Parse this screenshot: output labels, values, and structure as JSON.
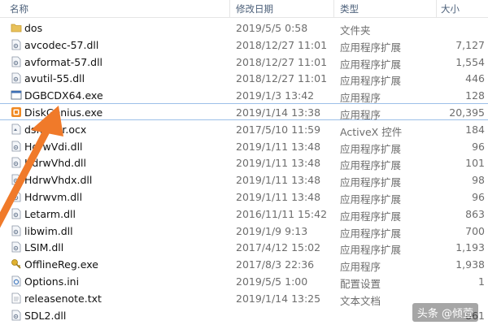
{
  "columns": {
    "name": "名称",
    "date": "修改日期",
    "type": "类型",
    "size": "大小"
  },
  "files": [
    {
      "name": "dos",
      "date": "2019/5/5 0:58",
      "type": "文件夹",
      "size": "",
      "icon": "folder-icon"
    },
    {
      "name": "avcodec-57.dll",
      "date": "2018/12/27 11:01",
      "type": "应用程序扩展",
      "size": "7,127",
      "icon": "dll-icon"
    },
    {
      "name": "avformat-57.dll",
      "date": "2018/12/27 11:01",
      "type": "应用程序扩展",
      "size": "1,554",
      "icon": "dll-icon"
    },
    {
      "name": "avutil-55.dll",
      "date": "2018/12/27 11:01",
      "type": "应用程序扩展",
      "size": "446",
      "icon": "dll-icon"
    },
    {
      "name": "DGBCDX64.exe",
      "date": "2019/1/3 13:42",
      "type": "应用程序",
      "size": "128",
      "icon": "exe-icon"
    },
    {
      "name": "DiskGenius.exe",
      "date": "2019/1/14 13:38",
      "type": "应用程序",
      "size": "20,395",
      "icon": "diskgenius-icon",
      "selected": true
    },
    {
      "name": "dsfamer.ocx",
      "date": "2017/5/10 11:59",
      "type": "ActiveX 控件",
      "size": "184",
      "icon": "ocx-icon"
    },
    {
      "name": "HdrwVdi.dll",
      "date": "2019/1/11 13:48",
      "type": "应用程序扩展",
      "size": "96",
      "icon": "dll-icon"
    },
    {
      "name": "HdrwVhd.dll",
      "date": "2019/1/11 13:48",
      "type": "应用程序扩展",
      "size": "101",
      "icon": "dll-icon"
    },
    {
      "name": "HdrwVhdx.dll",
      "date": "2019/1/11 13:48",
      "type": "应用程序扩展",
      "size": "98",
      "icon": "dll-icon"
    },
    {
      "name": "Hdrwvm.dll",
      "date": "2019/1/11 13:48",
      "type": "应用程序扩展",
      "size": "96",
      "icon": "dll-icon"
    },
    {
      "name": "Letarm.dll",
      "date": "2016/11/11 15:42",
      "type": "应用程序扩展",
      "size": "863",
      "icon": "dll-icon"
    },
    {
      "name": "libwim.dll",
      "date": "2019/1/9 9:13",
      "type": "应用程序扩展",
      "size": "700",
      "icon": "dll-icon"
    },
    {
      "name": "LSIM.dll",
      "date": "2017/4/12 15:02",
      "type": "应用程序扩展",
      "size": "1,193",
      "icon": "dll-icon"
    },
    {
      "name": "OfflineReg.exe",
      "date": "2017/8/3 22:36",
      "type": "应用程序",
      "size": "1,938",
      "icon": "key-exe-icon"
    },
    {
      "name": "Options.ini",
      "date": "2019/5/5 1:00",
      "type": "配置设置",
      "size": "1",
      "icon": "ini-icon"
    },
    {
      "name": "releasenote.txt",
      "date": "2019/1/14 13:25",
      "type": "文本文档",
      "size": "",
      "icon": "txt-icon"
    },
    {
      "name": "SDL2.dll",
      "date": "",
      "type": "",
      "size": "861",
      "icon": "dll-icon"
    }
  ],
  "watermark": "头条 @倾萱",
  "colors": {
    "header_text": "#4c607a",
    "selection_border": "#9cc0e8",
    "arrow": "#f07a2a",
    "folder": "#e8c15a"
  }
}
